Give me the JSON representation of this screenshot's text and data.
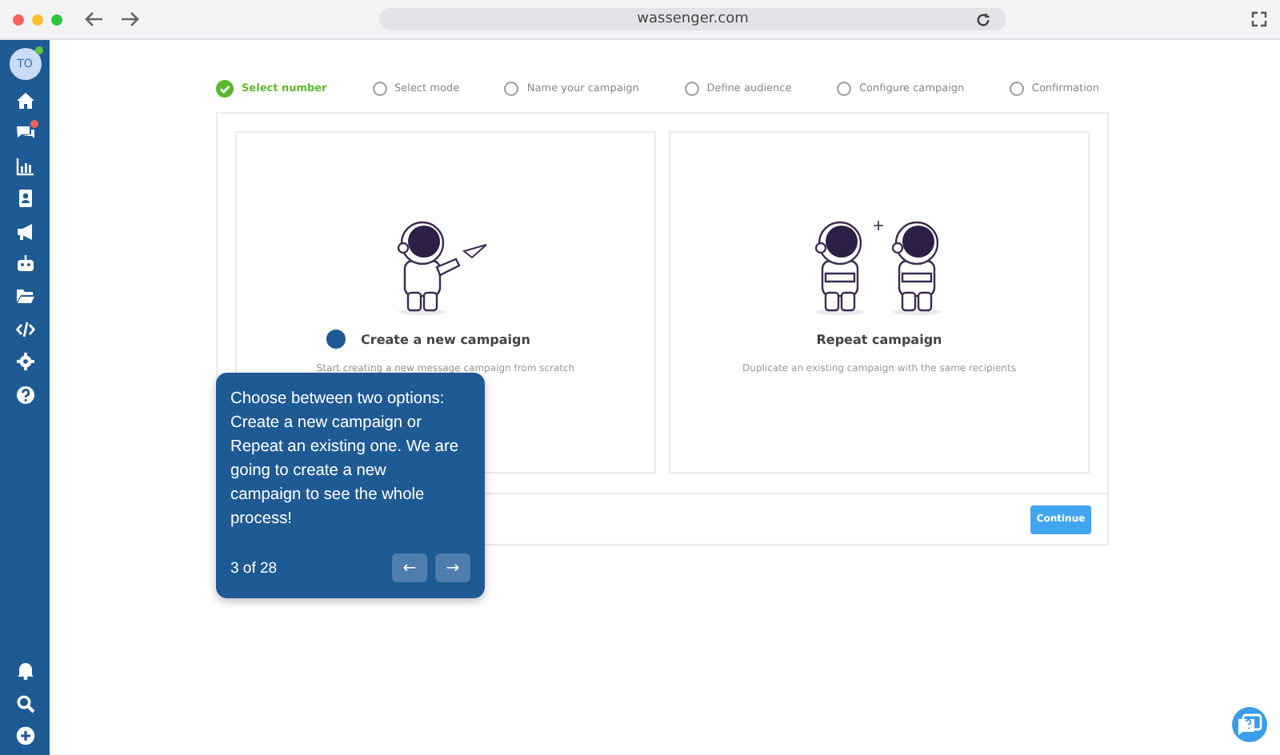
{
  "browser": {
    "url": "wassenger.com"
  },
  "sidebar": {
    "avatar": "TO",
    "online": true,
    "items": [
      {
        "kind": "home",
        "badge": false
      },
      {
        "kind": "chat",
        "badge": true
      },
      {
        "kind": "chart",
        "badge": false
      },
      {
        "kind": "contacts",
        "badge": false
      },
      {
        "kind": "megaphone",
        "badge": false
      },
      {
        "kind": "robot",
        "badge": false
      },
      {
        "kind": "folder",
        "badge": false
      },
      {
        "kind": "code",
        "badge": false
      },
      {
        "kind": "gear",
        "badge": false
      },
      {
        "kind": "help",
        "badge": false
      }
    ],
    "bottom_items": [
      {
        "kind": "bell"
      },
      {
        "kind": "search"
      },
      {
        "kind": "plus"
      }
    ]
  },
  "steps": [
    {
      "label": "Select number",
      "done": true
    },
    {
      "label": "Select mode",
      "done": false
    },
    {
      "label": "Name your campaign",
      "done": false
    },
    {
      "label": "Define audience",
      "done": false
    },
    {
      "label": "Configure campaign",
      "done": false
    },
    {
      "label": "Confirmation",
      "done": false
    }
  ],
  "options": [
    {
      "kind": "new",
      "title": "Create a new campaign",
      "description": "Start creating a new message campaign from scratch",
      "highlighted": true
    },
    {
      "kind": "repeat",
      "title": "Repeat campaign",
      "description": "Duplicate an existing campaign with the same recipients",
      "highlighted": false
    }
  ],
  "continue_button": "Continue",
  "tour": {
    "text": "Choose between two options: Create a new campaign or Repeat an existing one. We are going to create a new campaign to see the whole process!",
    "counter": "3 of 28",
    "prev": "←",
    "next": "→"
  }
}
